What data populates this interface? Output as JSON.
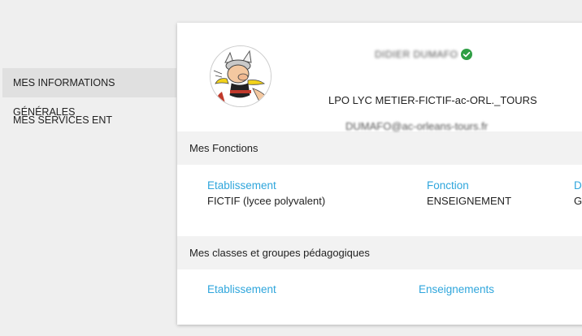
{
  "sidebar": {
    "items": [
      {
        "label": "MES INFORMATIONS GÉNÉRALES",
        "active": true
      },
      {
        "label": "MES SERVICES ENT",
        "active": false
      }
    ]
  },
  "profile": {
    "name": "DIDIER DUMAFO",
    "school": "LPO LYC METIER-FICTIF-ac-ORL._TOURS",
    "email_user": "DUMAFO",
    "email_domain_blur": "@ac-orleans-tours.fr",
    "verified_color": "#2e9e44",
    "avatar_icon": "cartoon-character-avatar"
  },
  "functions": {
    "title": "Mes Fonctions",
    "columns": [
      {
        "label": "Etablissement",
        "value": "FICTIF (lycee polyvalent)"
      },
      {
        "label": "Fonction",
        "value": "ENSEIGNEMENT"
      },
      {
        "label": "Di",
        "value": "G"
      }
    ]
  },
  "classes": {
    "title": "Mes classes et groupes pédagogiques",
    "columns": [
      {
        "label": "Etablissement"
      },
      {
        "label": "Enseignements"
      }
    ]
  },
  "colors": {
    "accent": "#2fa6dc",
    "section_bg": "#f2f2f2",
    "page_bg": "#efefef"
  }
}
